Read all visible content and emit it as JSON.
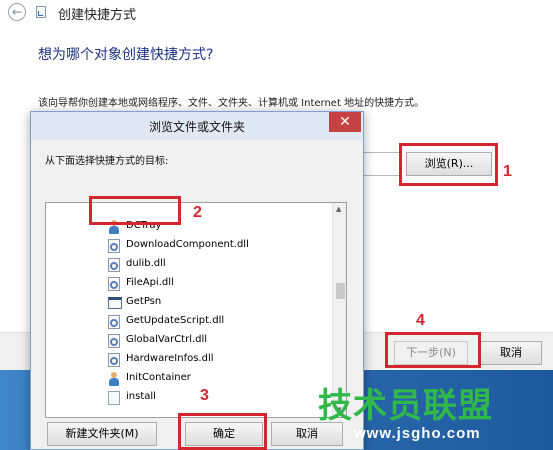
{
  "wizard": {
    "title": "创建快捷方式",
    "question": "想为哪个对象创建快捷方式?",
    "description": "该向导帮你创建本地或网络程序、文件、文件夹、计算机或 Internet 地址的快捷方式。",
    "browse_button": "浏览(R)...",
    "next_button": "下一步(N)",
    "cancel_button": "取消"
  },
  "dialog": {
    "title": "浏览文件或文件夹",
    "close_glyph": "✕",
    "prompt": "从下面选择快捷方式的目标:",
    "items": [
      {
        "name": "DCTray",
        "icon": "person-icon"
      },
      {
        "name": "DownloadComponent.dll",
        "icon": "gear-file-icon"
      },
      {
        "name": "dulib.dll",
        "icon": "gear-file-icon"
      },
      {
        "name": "FileApi.dll",
        "icon": "gear-file-icon"
      },
      {
        "name": "GetPsn",
        "icon": "exe-window-icon"
      },
      {
        "name": "GetUpdateScript.dll",
        "icon": "gear-file-icon"
      },
      {
        "name": "GlobalVarCtrl.dll",
        "icon": "gear-file-icon"
      },
      {
        "name": "HardwareInfos.dll",
        "icon": "gear-file-icon"
      },
      {
        "name": "InitContainer",
        "icon": "person-icon"
      },
      {
        "name": "install",
        "icon": "file-icon"
      }
    ],
    "new_folder_button": "新建文件夹(M)",
    "ok_button": "确定",
    "cancel_button": "取消"
  },
  "annotations": {
    "step1": "1",
    "step2": "2",
    "step3": "3",
    "step4": "4"
  },
  "watermark": {
    "text": "技术员联盟",
    "url": "www.jsgho.com"
  },
  "colors": {
    "annotation_red": "#d4262e",
    "watermark_green": "#31b84a",
    "title_blue": "#1e3287"
  }
}
